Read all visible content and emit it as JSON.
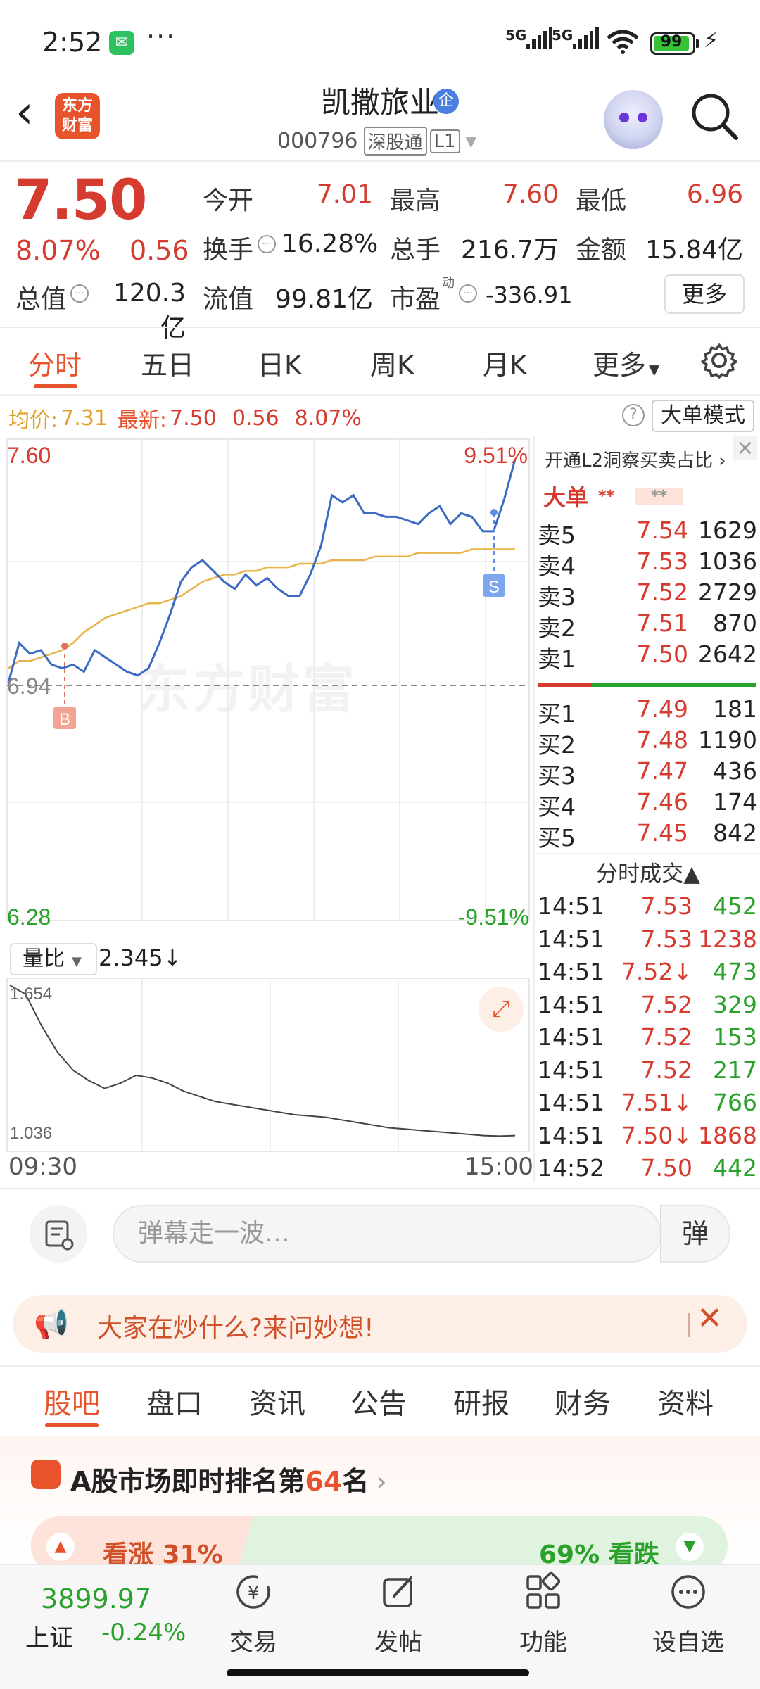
{
  "status_bar": {
    "time": "2:52",
    "net1": "5G",
    "net2": "5G",
    "battery": "99",
    "more": "···"
  },
  "header": {
    "back": "‹",
    "logo": "东方\n财富",
    "stock_name": "凯撒旅业",
    "badge": "企",
    "code": "000796",
    "tag1": "深股通",
    "tag2": "L1"
  },
  "quote": {
    "price": "7.50",
    "pct": "8.07%",
    "chg": "0.56",
    "open_label": "今开",
    "open": "7.01",
    "high_label": "最高",
    "high": "7.60",
    "low_label": "最低",
    "low": "6.96",
    "turnover_label": "换手",
    "turnover": "16.28%",
    "volume_label": "总手",
    "volume": "216.7万",
    "amount_label": "金额",
    "amount": "15.84亿",
    "mktcap_label": "总值",
    "mktcap": "120.3亿",
    "float_label": "流值",
    "float": "99.81亿",
    "pe_label": "市盈",
    "pe_sup": "动",
    "pe": "-336.91",
    "more_btn": "更多"
  },
  "tabs": [
    "分时",
    "五日",
    "日K",
    "周K",
    "月K",
    "更多"
  ],
  "avg_row": {
    "avg_label": "均价:",
    "avg": "7.31",
    "latest_label": "最新:",
    "latest": "7.50",
    "chg": "0.56",
    "pct": "8.07%",
    "help": "?",
    "big_order_btn": "大单模式"
  },
  "chart": {
    "y_high": "7.60",
    "y_pre_close": "6.94",
    "y_low": "6.28",
    "pct_high": "9.51%",
    "pct_low": "-9.51%",
    "watermark": "东方财富",
    "buy_marker": "B",
    "sell_marker": "S",
    "vol_ratio_label": "量比",
    "vol_ratio": "2.345↓",
    "vr_high": "1.654",
    "vr_low": "1.036",
    "time_open": "09:30",
    "time_close": "15:00"
  },
  "chart_data": {
    "type": "line",
    "title": "",
    "series": [
      {
        "values": [
          6.94,
          7.05,
          7.02,
          7.03,
          6.99,
          6.98,
          6.99,
          6.97,
          7.03,
          7.01,
          6.99,
          6.97,
          6.96,
          6.98,
          7.05,
          7.13,
          7.22,
          7.26,
          7.28,
          7.25,
          7.22,
          7.2,
          7.24,
          7.21,
          7.23,
          7.2,
          7.18,
          7.18,
          7.24,
          7.32,
          7.46,
          7.44,
          7.46,
          7.41,
          7.41,
          7.4,
          7.4,
          7.39,
          7.38,
          7.41,
          7.43,
          7.38,
          7.41,
          7.4,
          7.36,
          7.36,
          7.45,
          7.56
        ]
      },
      {
        "values": [
          6.98,
          7.0,
          7.0,
          7.01,
          7.02,
          7.03,
          7.05,
          7.08,
          7.1,
          7.12,
          7.13,
          7.14,
          7.15,
          7.16,
          7.16,
          7.17,
          7.18,
          7.2,
          7.22,
          7.23,
          7.24,
          7.24,
          7.25,
          7.25,
          7.26,
          7.26,
          7.26,
          7.27,
          7.27,
          7.27,
          7.28,
          7.28,
          7.28,
          7.28,
          7.29,
          7.29,
          7.29,
          7.29,
          7.3,
          7.3,
          7.3,
          7.3,
          7.3,
          7.31,
          7.31,
          7.31,
          7.31,
          7.31
        ]
      }
    ],
    "ylim": [
      6.28,
      7.6
    ],
    "pre_close": 6.94
  },
  "order_book": {
    "header": "开通L2洞察买卖占比 ›",
    "close": "×",
    "big_order": "大单",
    "stars1": "**",
    "stars2": "**",
    "asks": [
      {
        "label": "卖5",
        "price": "7.54",
        "vol": "1629"
      },
      {
        "label": "卖4",
        "price": "7.53",
        "vol": "1036"
      },
      {
        "label": "卖3",
        "price": "7.52",
        "vol": "2729"
      },
      {
        "label": "卖2",
        "price": "7.51",
        "vol": "870"
      },
      {
        "label": "卖1",
        "price": "7.50",
        "vol": "2642"
      }
    ],
    "bids": [
      {
        "label": "买1",
        "price": "7.49",
        "vol": "181"
      },
      {
        "label": "买2",
        "price": "7.48",
        "vol": "1190"
      },
      {
        "label": "买3",
        "price": "7.47",
        "vol": "436"
      },
      {
        "label": "买4",
        "price": "7.46",
        "vol": "174"
      },
      {
        "label": "买5",
        "price": "7.45",
        "vol": "842"
      }
    ],
    "trades_title": "分时成交▲",
    "trades": [
      {
        "t": "14:51",
        "p": "7.53",
        "v": "452"
      },
      {
        "t": "14:51",
        "p": "7.53",
        "v": "1238"
      },
      {
        "t": "14:51",
        "p": "7.52↓",
        "v": "473"
      },
      {
        "t": "14:51",
        "p": "7.52",
        "v": "329"
      },
      {
        "t": "14:51",
        "p": "7.52",
        "v": "153"
      },
      {
        "t": "14:51",
        "p": "7.52",
        "v": "217"
      },
      {
        "t": "14:51",
        "p": "7.51↓",
        "v": "766"
      },
      {
        "t": "14:51",
        "p": "7.50↓",
        "v": "1868"
      },
      {
        "t": "14:52",
        "p": "7.50",
        "v": "442"
      }
    ]
  },
  "comment": {
    "placeholder": "弹幕走一波…",
    "danmu": "弹"
  },
  "banner": {
    "text": "大家在炒什么?来问妙想!",
    "close": "✕"
  },
  "section_tabs": [
    "股吧",
    "盘口",
    "资讯",
    "公告",
    "研报",
    "财务",
    "资料"
  ],
  "rank": {
    "prefix": "A股市场即时排名第",
    "num": "64",
    "suffix": "名",
    "up": "看涨 31%",
    "down": "69% 看跌"
  },
  "bottom_nav": {
    "index_value": "3899.97",
    "index_name": "上证",
    "index_chg": "-0.24%",
    "items": [
      "交易",
      "发帖",
      "功能",
      "设自选"
    ]
  }
}
